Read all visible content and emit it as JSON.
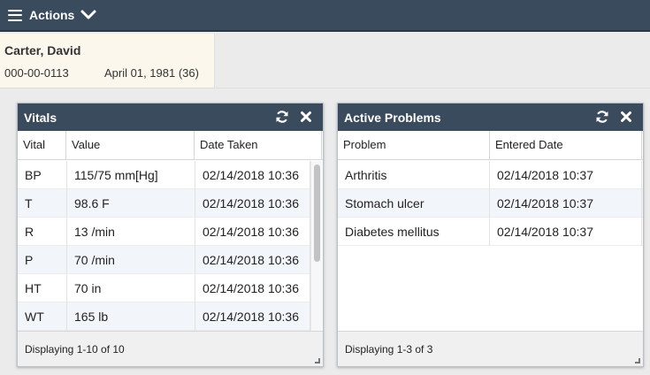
{
  "toolbar": {
    "actions_label": "Actions"
  },
  "patient": {
    "name": "Carter, David",
    "id": "000-00-0113",
    "dob": "April 01, 1981 (36)"
  },
  "vitals_panel": {
    "title": "Vitals",
    "columns": [
      "Vital",
      "Value",
      "Date Taken"
    ],
    "rows": [
      {
        "vital": "BP",
        "value": "115/75 mm[Hg]",
        "date": "02/14/2018 10:36"
      },
      {
        "vital": "T",
        "value": "98.6 F",
        "date": "02/14/2018 10:36"
      },
      {
        "vital": "R",
        "value": "13 /min",
        "date": "02/14/2018 10:36"
      },
      {
        "vital": "P",
        "value": "70 /min",
        "date": "02/14/2018 10:36"
      },
      {
        "vital": "HT",
        "value": "70 in",
        "date": "02/14/2018 10:36"
      },
      {
        "vital": "WT",
        "value": "165 lb",
        "date": "02/14/2018 10:36"
      }
    ],
    "footer": "Displaying 1-10 of 10"
  },
  "problems_panel": {
    "title": "Active Problems",
    "columns": [
      "Problem",
      "Entered Date"
    ],
    "rows": [
      {
        "problem": "Arthritis",
        "date": "02/14/2018 10:37"
      },
      {
        "problem": "Stomach ulcer",
        "date": "02/14/2018 10:37"
      },
      {
        "problem": "Diabetes mellitus",
        "date": "02/14/2018 10:37"
      }
    ],
    "footer": "Displaying 1-3 of 3"
  },
  "icons": {
    "menu": "hamburger-menu-icon",
    "dropdown": "chevron-down-icon",
    "refresh": "refresh-icon",
    "close": "close-icon",
    "resize": "resize-handle-icon"
  },
  "colors": {
    "header_bg": "#3a4b5e",
    "banner_bg": "#fbf7ed",
    "row_alt": "#f2f6fa"
  }
}
